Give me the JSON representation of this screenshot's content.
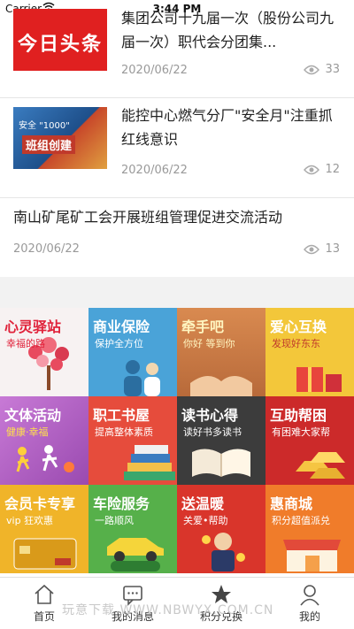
{
  "status": {
    "carrier": "Carrier",
    "time": "3:44 PM"
  },
  "news": [
    {
      "thumb_text": "今日头条",
      "title_line1": "集团公司十九届一次（股份公司九",
      "title_line2": "届一次）职代会分团集...",
      "date": "2020/06/22",
      "views": "33"
    },
    {
      "thumb_text_a": "安全 \"1000\"",
      "thumb_text_b": "班组创建",
      "title_line1": "能控中心燃气分厂\"安全月\"注重抓",
      "title_line2": "红线意识",
      "date": "2020/06/22",
      "views": "12"
    },
    {
      "title_line1": "南山矿尾矿工会开展班组管理促进交流活动",
      "date": "2020/06/22",
      "views": "13"
    }
  ],
  "tiles": [
    {
      "title": "心灵驿站",
      "sub": "幸福的路",
      "color": "#f5f5f5"
    },
    {
      "title": "商业保险",
      "sub": "保护全方位",
      "color": "#4aa3d8"
    },
    {
      "title": "牵手吧",
      "sub": "你好 等到你",
      "color": "#e8823f"
    },
    {
      "title": "爱心互换",
      "sub": "发现好东东",
      "color": "#f3c73a"
    },
    {
      "title": "文体活动",
      "sub": "健康·幸福",
      "color": "#b86cc8"
    },
    {
      "title": "职工书屋",
      "sub": "提高整体素质",
      "color": "#e64c3c"
    },
    {
      "title": "读书心得",
      "sub": "读好书多读书",
      "color": "#3c3c3c"
    },
    {
      "title": "互助帮困",
      "sub": "有困难大家帮",
      "color": "#cc2a2a"
    },
    {
      "title": "会员卡专享",
      "sub": "vip 狂欢惠",
      "color": "#f0b429"
    },
    {
      "title": "车险服务",
      "sub": "一路顺风",
      "color": "#56b04a"
    },
    {
      "title": "送温暖",
      "sub": "关爱•帮助",
      "color": "#d9352b"
    },
    {
      "title": "惠商城",
      "sub": "积分超值派兑",
      "color": "#f07c2a"
    }
  ],
  "tabs": [
    {
      "label": "首页",
      "icon": "home-icon"
    },
    {
      "label": "我的消息",
      "icon": "message-icon"
    },
    {
      "label": "积分兑换",
      "icon": "star-icon"
    },
    {
      "label": "我的",
      "icon": "user-icon"
    }
  ],
  "watermark": "玩意下载 WWW.NBWYX.COM.CN"
}
